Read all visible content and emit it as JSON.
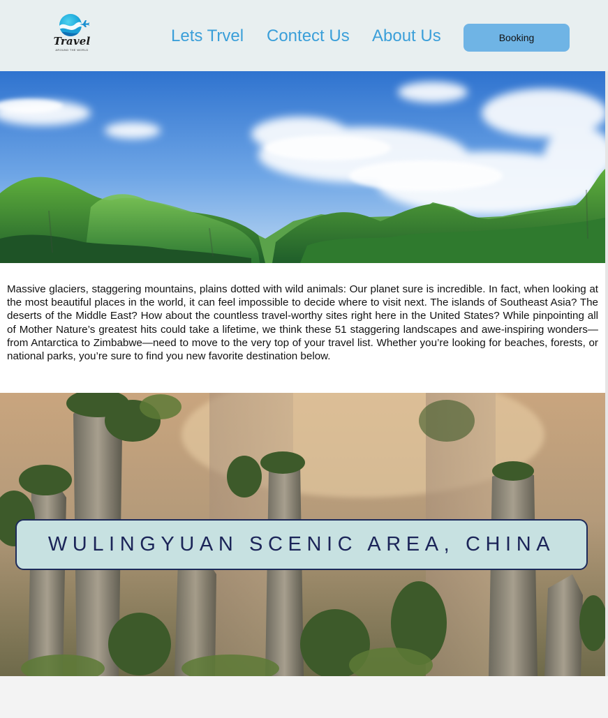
{
  "header": {
    "logo": {
      "name": "Travel",
      "tagline": "AROUND THE WORLD",
      "icon": "wave-globe-plane-icon"
    },
    "nav": [
      {
        "label": "Lets Trvel"
      },
      {
        "label": "Contect Us"
      },
      {
        "label": "About Us"
      }
    ],
    "booking_label": "Booking"
  },
  "hero": {
    "image": "green-karst-mountains-blue-sky"
  },
  "intro": {
    "text": "Massive glaciers, staggering mountains, plains dotted with wild animals: Our planet sure is incredible. In fact, when looking at the most beautiful places in the world, it can feel impossible to decide where to visit next. The islands of Southeast Asia? The deserts of the Middle East? How about the countless travel-worthy sites right here in the United States? While pinpointing all of Mother Nature’s greatest hits could take a lifetime, we think these 51 staggering landscapes and awe-inspiring wonders—from Antarctica to Zimbabwe—need to move to the very top of your travel list. Whether you’re looking for beaches, forests, or national parks, you’re sure to find you new favorite destination below."
  },
  "scenic": {
    "image": "sandstone-pillars-misty-forest",
    "caption": "WULINGYUAN SCENIC AREA, CHINA"
  },
  "colors": {
    "header_bg": "#e8eff0",
    "nav_link": "#3b9fd9",
    "booking_bg": "#6fb4e5",
    "caption_bg": "#c7e1e1",
    "caption_text": "#1b2458"
  }
}
